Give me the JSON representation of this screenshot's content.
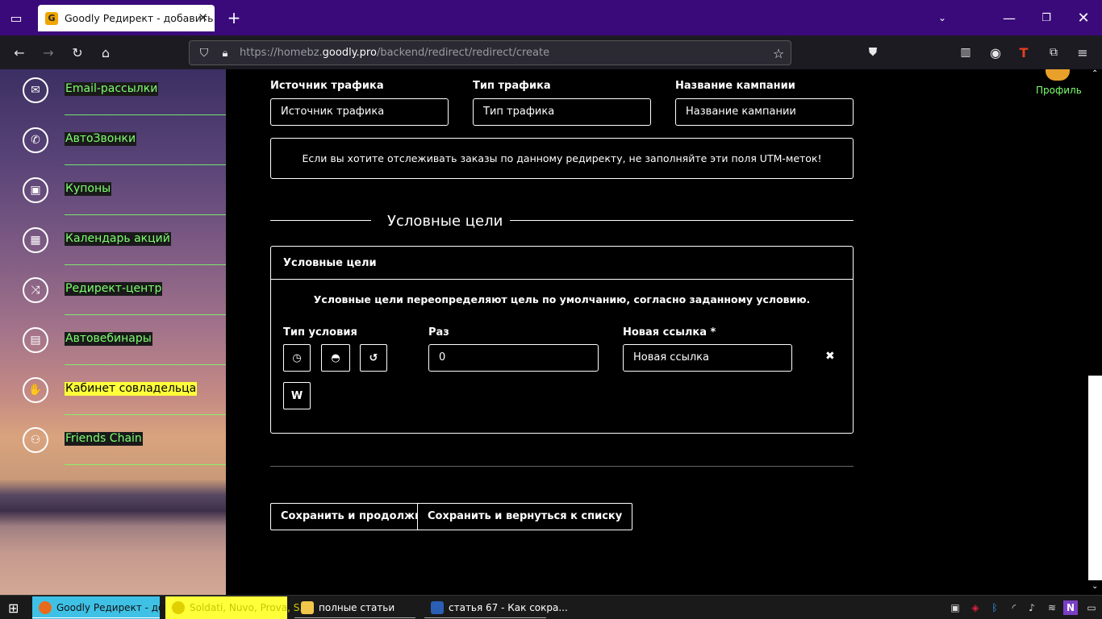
{
  "browser": {
    "tab_title": "Goodly Редирект - добавить",
    "url_prefix": "https://homebz.",
    "url_domain": "goodly.pro",
    "url_path": "/backend/redirect/redirect/create"
  },
  "sidebar": {
    "items": [
      {
        "label": "Email-рассылки",
        "icon": "envelope-icon"
      },
      {
        "label": "АвтоЗвонки",
        "icon": "phone-icon"
      },
      {
        "label": "Купоны",
        "icon": "coupon-icon"
      },
      {
        "label": "Календарь акций",
        "icon": "calendar-icon"
      },
      {
        "label": "Редирект-центр",
        "icon": "shuffle-icon"
      },
      {
        "label": "Автовебинары",
        "icon": "webinar-icon"
      },
      {
        "label": "Кабинет совладельца",
        "icon": "handshake-icon",
        "highlight": "#ffff3a"
      },
      {
        "label": "Friends Chain",
        "icon": "friends-icon"
      }
    ]
  },
  "form": {
    "source_label": "Источник трафика",
    "source_placeholder": "Источник трафика",
    "type_label": "Тип трафика",
    "type_placeholder": "Тип трафика",
    "campaign_label": "Название кампании",
    "campaign_placeholder": "Название кампании",
    "utm_notice": "Если вы хотите отслеживать заказы по данному редиректу, не заполняйте эти поля UTM-меток!"
  },
  "goals": {
    "section_title": "Условные цели",
    "panel_title": "Условные цели",
    "description": "Условные цели переопределяют цель по умолчанию, согласно заданному условию.",
    "condition_type_label": "Тип условия",
    "times_label": "Раз",
    "times_value": "0",
    "new_link_label": "Новая ссылка *",
    "new_link_placeholder": "Новая ссылка",
    "w_button": "W",
    "remove_symbol": "✖",
    "condition_icons": [
      "clock-icon",
      "dashboard-icon",
      "history-icon"
    ]
  },
  "actions": {
    "save_continue": "Сохранить и продолжить",
    "save_return": "Сохранить и вернуться к списку"
  },
  "profile": {
    "label": "Профиль"
  },
  "taskbar": {
    "items": [
      {
        "label": "Goodly Редирект - доб...",
        "active": true
      },
      {
        "label": "Soldati, Nuvo, Prova, S...",
        "highlight": true
      },
      {
        "label": "полные статьи"
      },
      {
        "label": "статья 67 - Как сокра..."
      }
    ]
  },
  "colors": {
    "accent_green": "#7dff6e",
    "tabbar_purple": "#3a0a7a",
    "highlight_yellow": "#ffff3a",
    "taskbar_active": "#3fc1e6"
  }
}
